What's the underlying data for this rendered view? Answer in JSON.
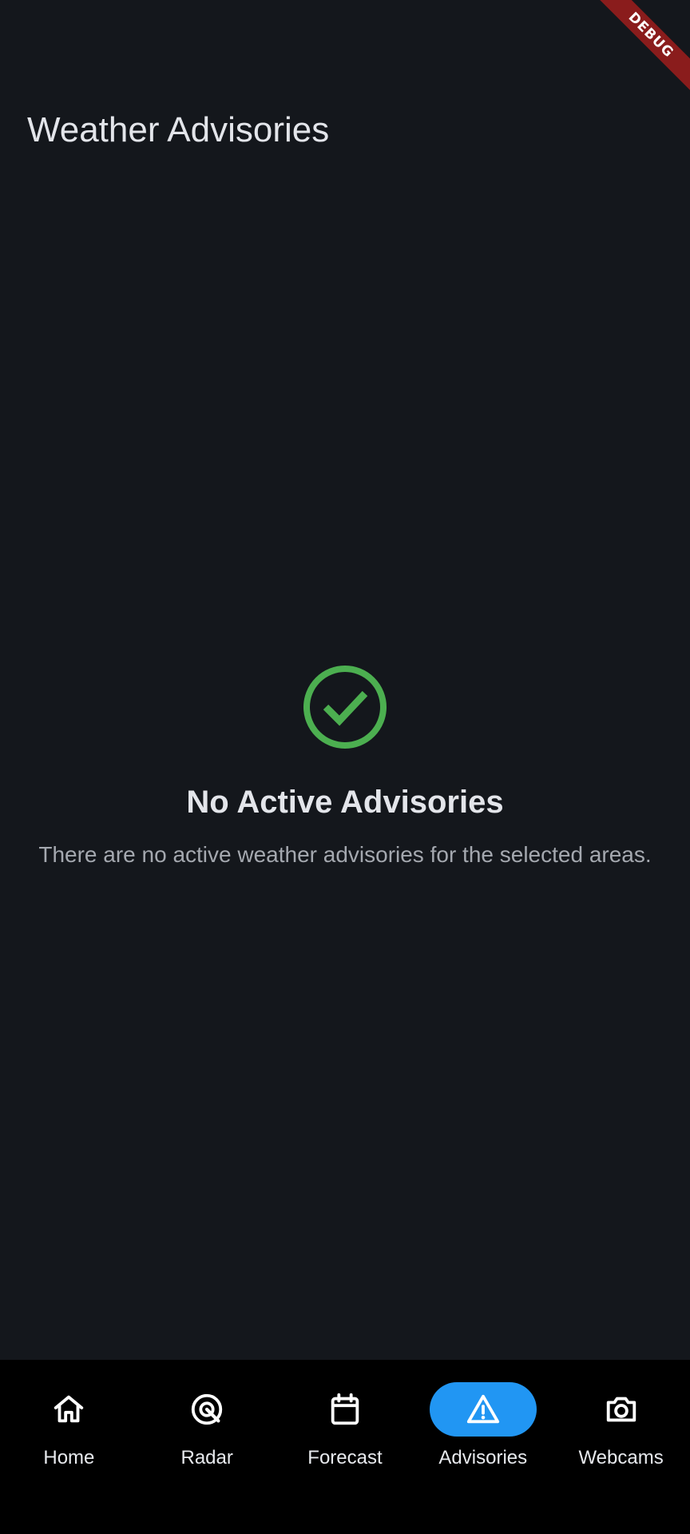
{
  "debug_banner": {
    "label": "DEBUG",
    "color": "#8a1c1c"
  },
  "app_bar": {
    "title": "Weather Advisories"
  },
  "empty_state": {
    "icon": "check-circle-icon",
    "icon_color": "#4caf50",
    "title": "No Active Advisories",
    "message": "There are no active weather advisories for the selected areas."
  },
  "bottom_nav": {
    "active_index": 3,
    "active_color": "#2196f3",
    "items": [
      {
        "label": "Home",
        "icon": "home-icon"
      },
      {
        "label": "Radar",
        "icon": "radar-icon"
      },
      {
        "label": "Forecast",
        "icon": "calendar-icon"
      },
      {
        "label": "Advisories",
        "icon": "warning-icon"
      },
      {
        "label": "Webcams",
        "icon": "camera-icon"
      }
    ]
  }
}
